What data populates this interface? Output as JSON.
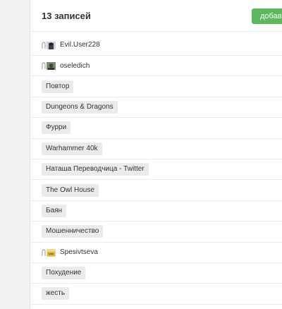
{
  "header": {
    "count_label": "13 записей",
    "add_button_label": "добавить"
  },
  "items": [
    {
      "type": "user",
      "label": "Evil.User228",
      "avatar_color": "#3a3f4a"
    },
    {
      "type": "user",
      "label": "oseledich",
      "avatar_color": "#5a6a52"
    },
    {
      "type": "tag",
      "label": "Повтор"
    },
    {
      "type": "tag",
      "label": "Dungeons & Dragons"
    },
    {
      "type": "tag",
      "label": "Фурри"
    },
    {
      "type": "tag",
      "label": "Warhammer 40k"
    },
    {
      "type": "tag",
      "label": "Наташа Переводчица - Twitter"
    },
    {
      "type": "tag",
      "label": "The Owl House"
    },
    {
      "type": "tag",
      "label": "Баян"
    },
    {
      "type": "tag",
      "label": "Мошенничество"
    },
    {
      "type": "user",
      "label": "Spesivtseva",
      "avatar_color": "#d9b24a"
    },
    {
      "type": "tag",
      "label": "Похудение"
    },
    {
      "type": "tag",
      "label": "жесть"
    }
  ],
  "colors": {
    "accent": "#5cb85c",
    "tag_bg": "#ebebeb",
    "divider": "#ececec"
  }
}
